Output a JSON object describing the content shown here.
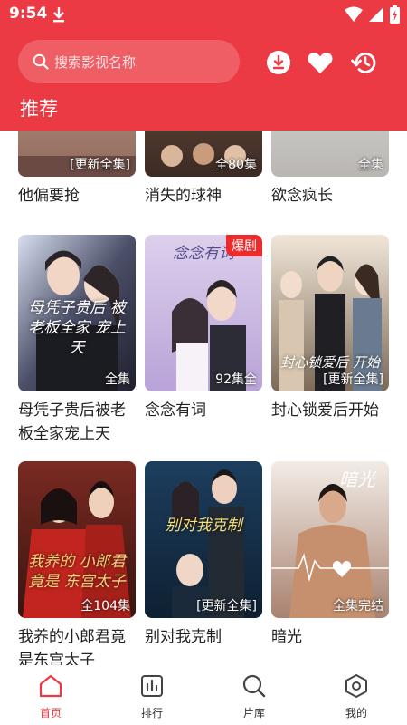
{
  "status_bar": {
    "time": "9:54"
  },
  "search": {
    "placeholder": "搜索影视名称"
  },
  "page": {
    "title": "推荐"
  },
  "dramas": [
    {
      "title": "他偏要抢",
      "label": "[更新全集]"
    },
    {
      "title": "消失的球神",
      "label": "全80集"
    },
    {
      "title": "欲念疯长",
      "label": "全集"
    },
    {
      "title": "母凭子贵后被老板全家宠上天",
      "label": "全集",
      "poster_text": "母凭子贵后 被老板全家 宠上天"
    },
    {
      "title": "念念有词",
      "label": "92集全",
      "badge": "爆剧",
      "poster_text": "念念有词"
    },
    {
      "title": "封心锁爱后开始",
      "label": "[更新全集]",
      "poster_text": "封心锁爱后 开始"
    },
    {
      "title": "我养的小郎君竟是东宫太子",
      "label": "全104集",
      "poster_text": "我养的 小郎君竟是 东宫太子"
    },
    {
      "title": "别对我克制",
      "label": "[更新全集]",
      "poster_text": "别对我克制"
    },
    {
      "title": "暗光",
      "label": "全集完结",
      "poster_text": "暗光"
    }
  ],
  "nav": [
    {
      "label": "首页",
      "icon": "home-icon",
      "active": true
    },
    {
      "label": "排行",
      "icon": "ranking-icon",
      "active": false
    },
    {
      "label": "片库",
      "icon": "search-icon",
      "active": false
    },
    {
      "label": "我的",
      "icon": "profile-icon",
      "active": false
    }
  ],
  "colors": {
    "accent": "#ec3a44",
    "badge": "#ee2a2a"
  }
}
